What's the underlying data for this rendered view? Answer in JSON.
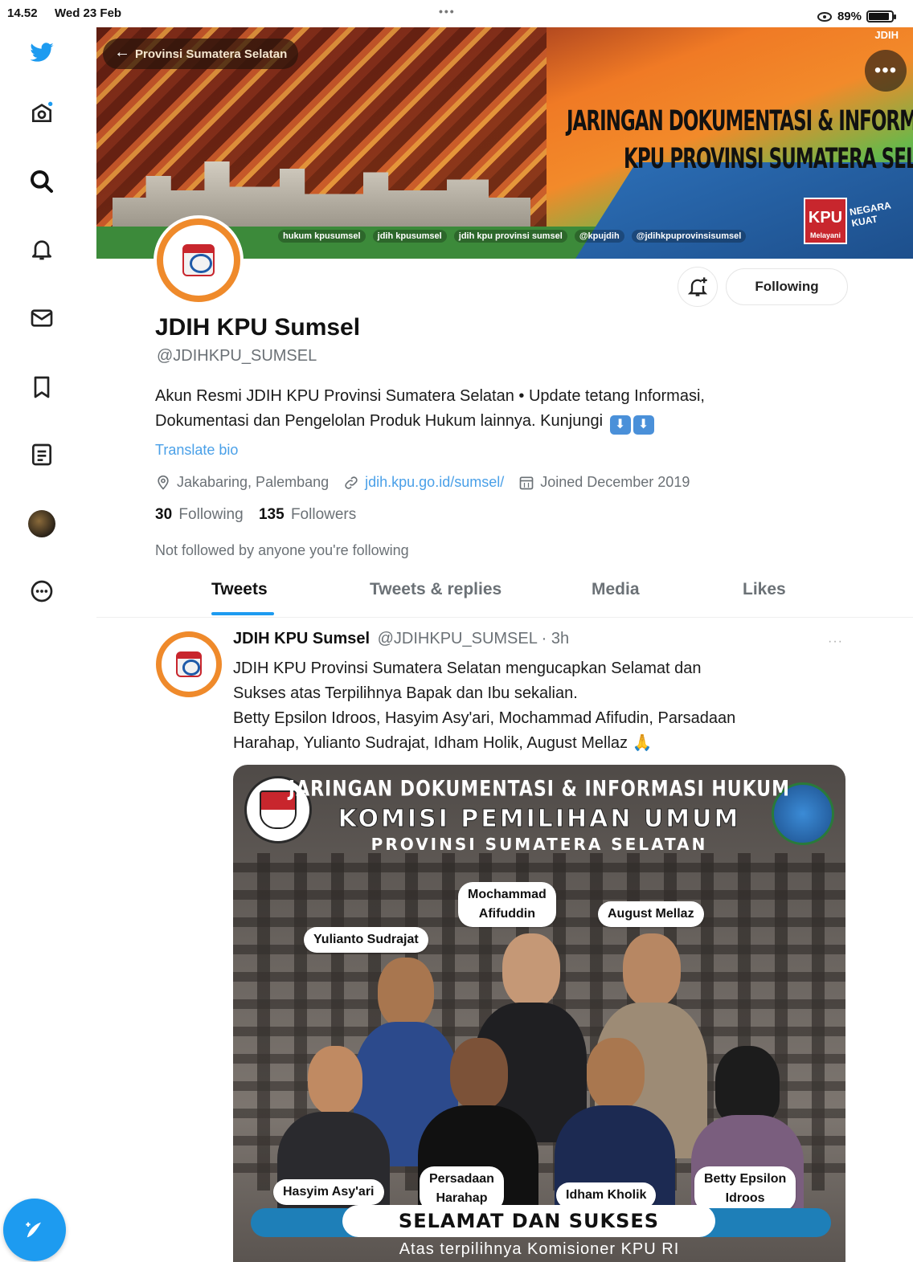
{
  "status_bar": {
    "time": "14.52",
    "date": "Wed 23 Feb",
    "battery": "89%",
    "battery_level": 0.89,
    "dots": "•••"
  },
  "rail": {
    "icons": [
      "twitter-bird-icon",
      "home-icon",
      "explore-search-icon",
      "notifications-bell-icon",
      "messages-envelope-icon",
      "bookmarks-icon",
      "lists-icon",
      "profile-avatar",
      "more-circle-icon"
    ],
    "compose_icon": "compose-feather-icon"
  },
  "banner": {
    "back_label": "Provinsi Sumatera Selatan",
    "title_line1": "JARINGAN DOKUMENTASI & INFORMASI HUKUM (JDIH)",
    "title_line2": "KPU PROVINSI SUMATERA SELATAN",
    "kpu_box": "KPU",
    "kpu_sub": "Melayani",
    "negara": "NEGARA KUAT",
    "socials": [
      "hukum kpusumsel",
      "jdih kpusumsel",
      "jdih kpu provinsi sumsel",
      "@kpujdih",
      "@jdihkpuprovinsisumsel"
    ],
    "top_right": "JDIH",
    "more": "•••"
  },
  "profile": {
    "name": "JDIH KPU Sumsel",
    "handle": "@JDIHKPU_SUMSEL",
    "bio_line1": "Akun Resmi JDIH KPU Provinsi Sumatera Selatan • Update tetang Informasi,",
    "bio_line2": "Dokumentasi dan Pengelolan Produk Hukum lainnya. Kunjungi",
    "bio_emoji": "⬇",
    "translate": "Translate bio",
    "location": "Jakabaring, Palembang",
    "website": "jdih.kpu.go.id/sumsel/",
    "joined": "Joined December 2019",
    "following_count": "30",
    "following_label": "Following",
    "followers_count": "135",
    "followers_label": "Followers",
    "not_followed": "Not followed by anyone you're following",
    "following_button": "Following"
  },
  "tabs": [
    {
      "label": "Tweets",
      "active": true
    },
    {
      "label": "Tweets & replies",
      "active": false
    },
    {
      "label": "Media",
      "active": false
    },
    {
      "label": "Likes",
      "active": false
    }
  ],
  "tweet": {
    "name": "JDIH KPU Sumsel",
    "meta": "@JDIHKPU_SUMSEL · 3h",
    "more": "···",
    "lines": [
      "JDIH KPU Provinsi Sumatera Selatan mengucapkan Selamat dan",
      "Sukses atas Terpilihnya Bapak dan Ibu sekalian.",
      "Betty Epsilon Idroos, Hasyim Asy'ari, Mochammad Afifudin, Parsadaan",
      "Harahap, Yulianto Sudrajat, Idham Holik,  August Mellaz 🙏"
    ],
    "image": {
      "line1": "JARINGAN DOKUMENTASI & INFORMASI HUKUM",
      "line2": "KOMISI PEMILIHAN UMUM",
      "line3": "PROVINSI SUMATERA SELATAN",
      "names": {
        "mochammad": [
          "Mochammad",
          "Afifuddin"
        ],
        "august": "August Mellaz",
        "yulianto": "Yulianto Sudrajat",
        "hasyim": "Hasyim Asy'ari",
        "persadaan": [
          "Persadaan",
          "Harahap"
        ],
        "idham": "Idham Kholik",
        "betty": [
          "Betty Epsilon",
          "Idroos"
        ]
      },
      "selamat": "SELAMAT DAN SUKSES",
      "subline": "Atas terpilihnya Komisioner KPU RI"
    }
  },
  "colors": {
    "accent": "#1d9bf0",
    "avatar_ring": "#ef8a2b",
    "link": "#4aa0e8"
  }
}
